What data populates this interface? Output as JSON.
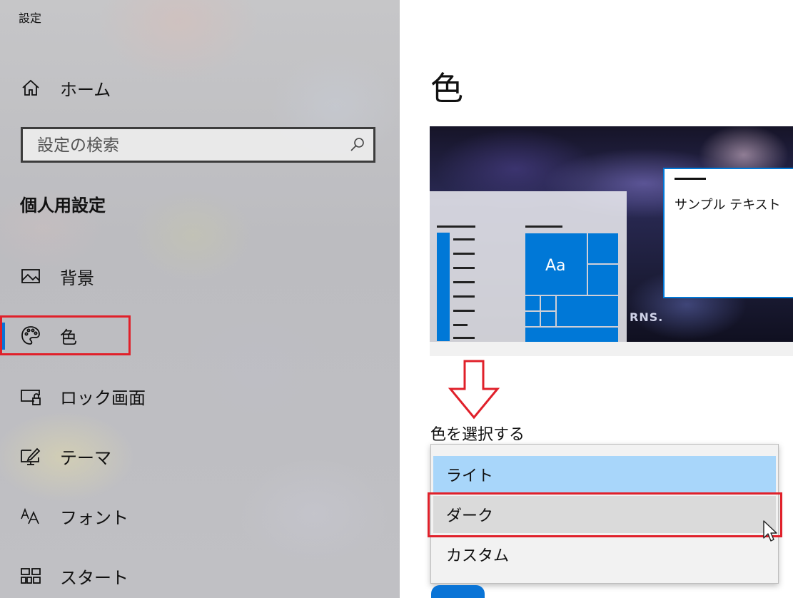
{
  "window": {
    "title": "設定"
  },
  "sidebar": {
    "home_label": "ホーム",
    "search_placeholder": "設定の検索",
    "section_heading": "個人用設定",
    "items": [
      {
        "label": "背景",
        "icon": "image-icon"
      },
      {
        "label": "色",
        "icon": "palette-icon",
        "selected": true
      },
      {
        "label": "ロック画面",
        "icon": "lock-screen-icon"
      },
      {
        "label": "テーマ",
        "icon": "theme-icon"
      },
      {
        "label": "フォント",
        "icon": "font-icon"
      },
      {
        "label": "スタート",
        "icon": "start-icon"
      }
    ]
  },
  "main": {
    "title": "色",
    "preview": {
      "sample_text": "サンプル テキスト",
      "tile_text": "Aa",
      "wallpaper_text": "RNS."
    },
    "choose_color_label": "色を選択する",
    "dropdown": {
      "options": [
        "ライト",
        "ダーク",
        "カスタム"
      ],
      "hovered": "ダーク",
      "highlighted": "ライト"
    }
  },
  "colors": {
    "accent": "#0078d7",
    "highlight": "#a8d6fa",
    "annotation_red": "#e0202a"
  }
}
